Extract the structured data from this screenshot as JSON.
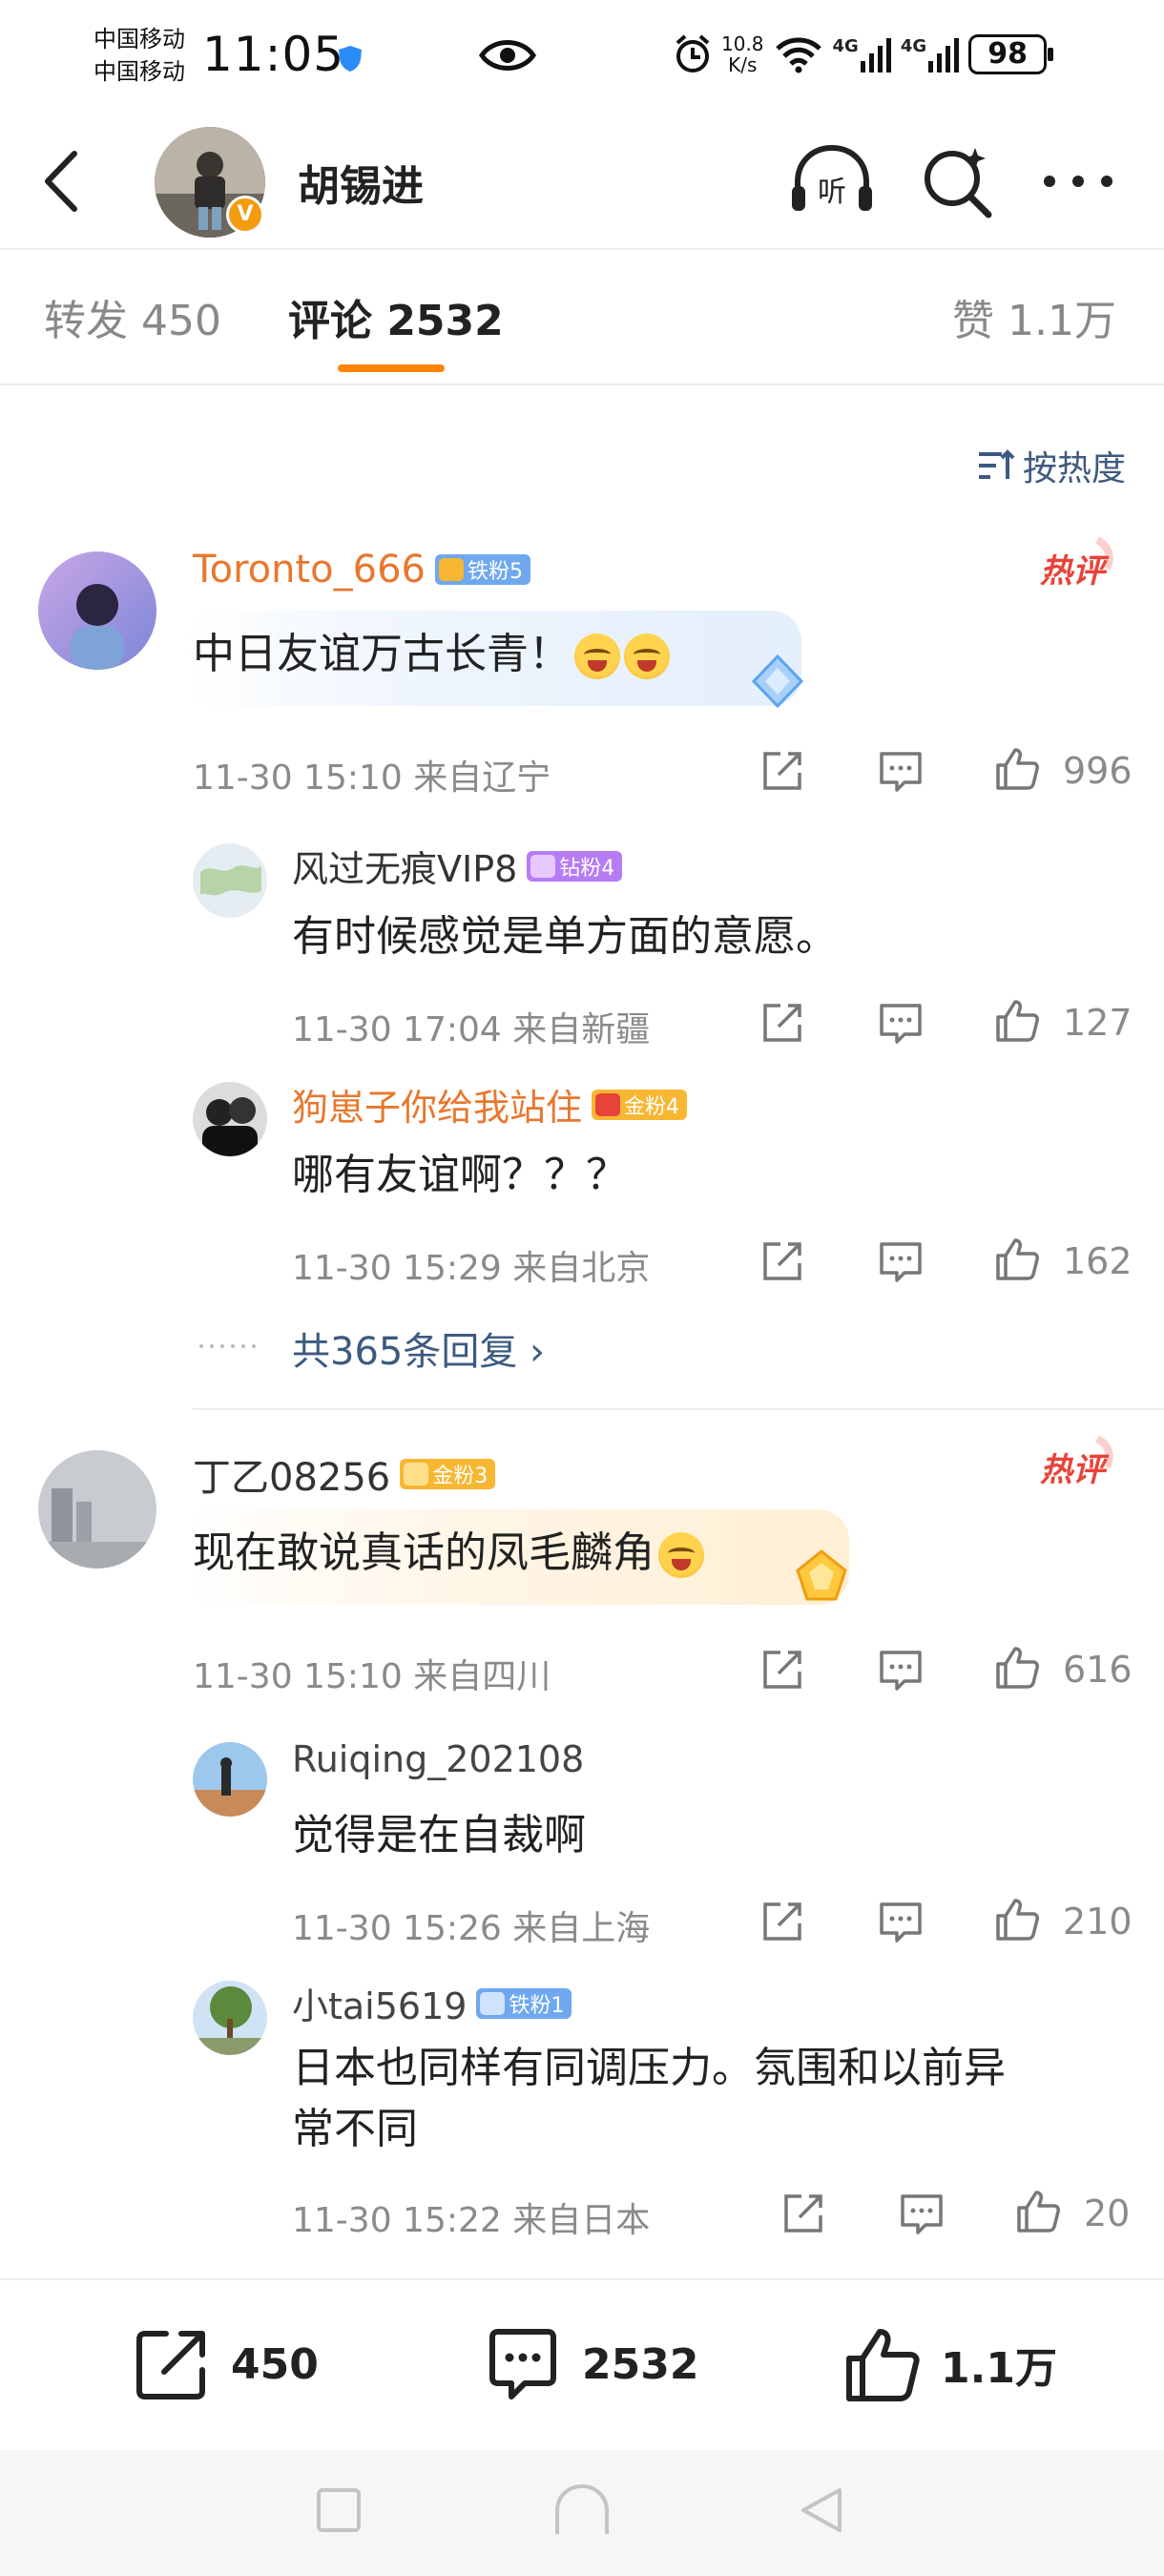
{
  "status_bar": {
    "carrier_1": "中国移动",
    "carrier_2": "中国移动",
    "time": "11:05",
    "net_speed_value": "10.8",
    "net_speed_unit": "K/s",
    "signal_1": "4G",
    "signal_2": "4G",
    "battery": "98"
  },
  "header": {
    "username": "胡锡进",
    "verified_badge": "V"
  },
  "tabs": [
    {
      "label": "转发 450"
    },
    {
      "label": "评论 2532"
    },
    {
      "label": "赞 1.1万"
    }
  ],
  "sort_label": "按热度",
  "comments": [
    {
      "name": "Toronto_666",
      "badge": "铁粉5",
      "text": "中日友谊万古长青！",
      "hot": "热评",
      "time": "11-30 15:10",
      "location": "来自辽宁",
      "likes": "996",
      "replies": [
        {
          "name": "风过无痕VIP8",
          "badge": "钻粉4",
          "text": "有时候感觉是单方面的意愿。",
          "time": "11-30 17:04",
          "location": "来自新疆",
          "likes": "127"
        },
        {
          "name": "狗崽子你给我站住",
          "badge": "金粉4",
          "text": "哪有友谊啊？？？",
          "time": "11-30 15:29",
          "location": "来自北京",
          "likes": "162"
        }
      ],
      "more_replies": "共365条回复 ›"
    },
    {
      "name": "丁乙08256",
      "badge": "金粉3",
      "text": "现在敢说真话的凤毛麟角",
      "hot": "热评",
      "time": "11-30 15:10",
      "location": "来自四川",
      "likes": "616",
      "replies": [
        {
          "name": "Ruiqing_202108",
          "text": "觉得是在自裁啊",
          "time": "11-30 15:26",
          "location": "来自上海",
          "likes": "210"
        },
        {
          "name": "小tai5619",
          "badge": "铁粉1",
          "text_line1": "日本也同样有同调压力。氛围和以前异",
          "text_line2": "常不同",
          "time": "11-30 15:22",
          "location": "来自日本",
          "likes": "20"
        }
      ]
    }
  ],
  "bottom_bar": {
    "repost_count": "450",
    "comment_count": "2532",
    "like_count": "1.1万"
  },
  "colors": {
    "accent_orange": "#ff8200",
    "link_blue": "#3d5a80",
    "hot_red": "#e8433a",
    "iron_fan": "#6fa8ef",
    "gold_fan": "#f7b733",
    "diamond_fan": "#b57cf3"
  }
}
